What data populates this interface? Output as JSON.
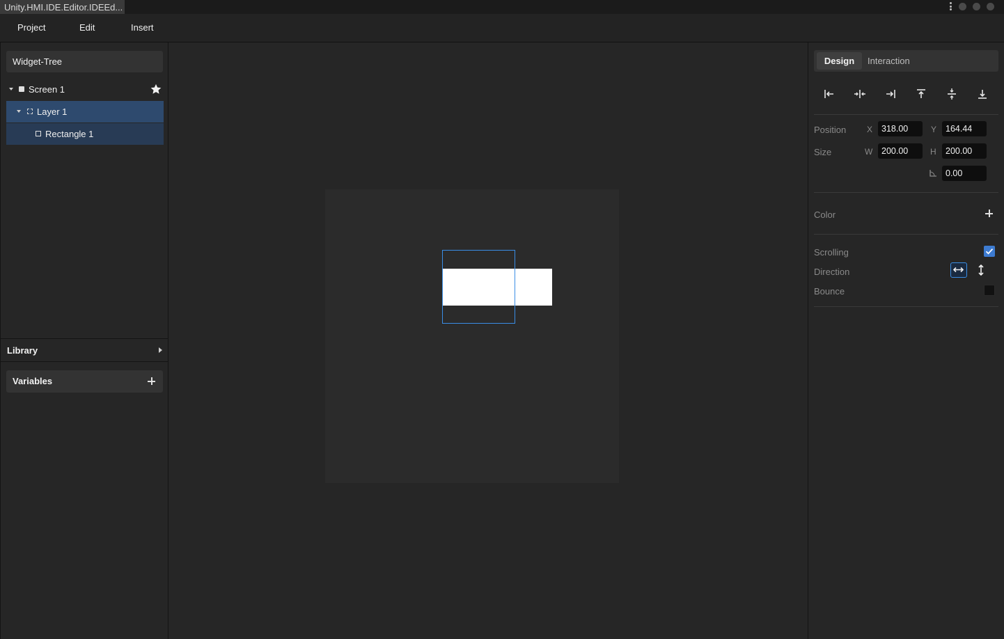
{
  "window": {
    "title": "Unity.HMI.IDE.Editor.IDEEd..."
  },
  "menu": {
    "items": [
      "Project",
      "Edit",
      "Insert"
    ]
  },
  "widget_tree": {
    "title": "Widget-Tree",
    "items": [
      {
        "label": "Screen 1",
        "selected": false
      },
      {
        "label": "Layer 1",
        "selected": true
      },
      {
        "label": "Rectangle 1",
        "selected": true
      }
    ]
  },
  "library": {
    "title": "Library"
  },
  "variables": {
    "title": "Variables"
  },
  "inspector": {
    "tabs": [
      "Design",
      "Interaction"
    ],
    "active_tab": "Design",
    "position_label": "Position",
    "size_label": "Size",
    "x_label": "X",
    "y_label": "Y",
    "w_label": "W",
    "h_label": "H",
    "x": "318.00",
    "y": "164.44",
    "w": "200.00",
    "h": "200.00",
    "rotation": "0.00",
    "color_label": "Color",
    "scrolling_label": "Scrolling",
    "scrolling_checked": true,
    "direction_label": "Direction",
    "bounce_label": "Bounce",
    "bounce_checked": false
  },
  "colors": {
    "accent": "#3a8ee6",
    "selection": "#2e4a6e",
    "checkbox": "#3d7bd1"
  }
}
